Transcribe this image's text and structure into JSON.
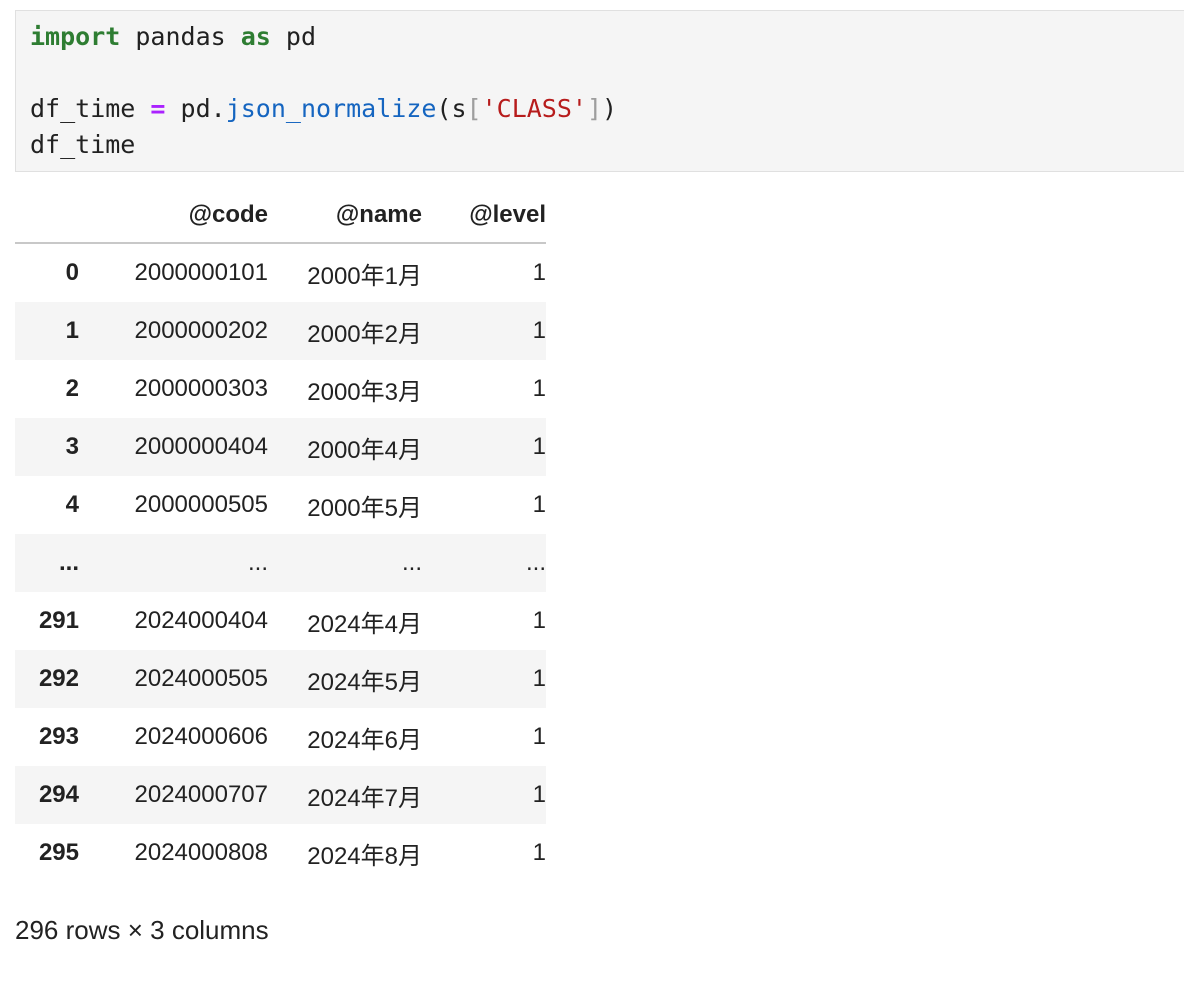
{
  "code_cell": {
    "line1": {
      "kw_import": "import",
      "t1": " pandas ",
      "kw_as": "as",
      "t2": " pd"
    },
    "line3": {
      "var": "df_time ",
      "op": "=",
      "t1": " pd.",
      "fn": "json_normalize",
      "t2": "(s",
      "lb": "[",
      "str": "'CLASS'",
      "rb": "]",
      "t3": ")"
    },
    "line4": "df_time"
  },
  "table": {
    "columns": [
      "",
      "@code",
      "@name",
      "@level"
    ],
    "rows": [
      {
        "idx": "0",
        "code": "2000000101",
        "name": "2000年1月",
        "level": "1"
      },
      {
        "idx": "1",
        "code": "2000000202",
        "name": "2000年2月",
        "level": "1"
      },
      {
        "idx": "2",
        "code": "2000000303",
        "name": "2000年3月",
        "level": "1"
      },
      {
        "idx": "3",
        "code": "2000000404",
        "name": "2000年4月",
        "level": "1"
      },
      {
        "idx": "4",
        "code": "2000000505",
        "name": "2000年5月",
        "level": "1"
      },
      {
        "idx": "...",
        "code": "...",
        "name": "...",
        "level": "..."
      },
      {
        "idx": "291",
        "code": "2024000404",
        "name": "2024年4月",
        "level": "1"
      },
      {
        "idx": "292",
        "code": "2024000505",
        "name": "2024年5月",
        "level": "1"
      },
      {
        "idx": "293",
        "code": "2024000606",
        "name": "2024年6月",
        "level": "1"
      },
      {
        "idx": "294",
        "code": "2024000707",
        "name": "2024年7月",
        "level": "1"
      },
      {
        "idx": "295",
        "code": "2024000808",
        "name": "2024年8月",
        "level": "1"
      }
    ]
  },
  "summary": "296 rows × 3 columns"
}
